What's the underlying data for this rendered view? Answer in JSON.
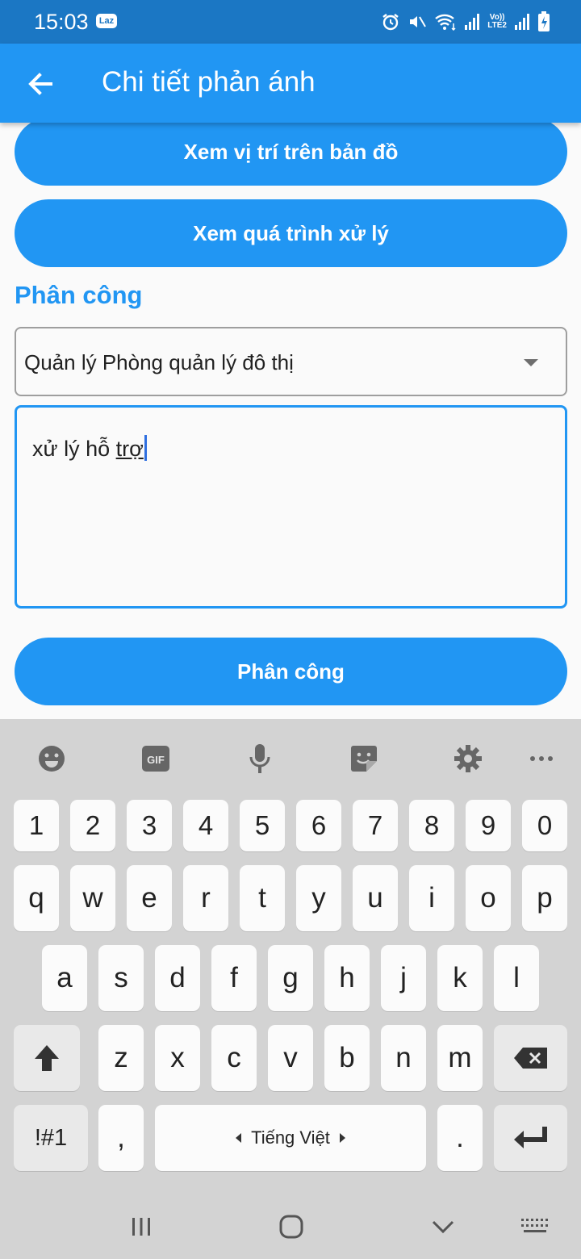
{
  "status_bar": {
    "time": "15:03",
    "notification_badge": "Laz",
    "icons": [
      "alarm-icon",
      "mute-icon",
      "wifi-icon",
      "signal-icon",
      "volte-icon",
      "signal-icon",
      "battery-charging-icon"
    ],
    "volte_top": "Vo))",
    "volte_bottom": "LTE2"
  },
  "app_bar": {
    "title": "Chi tiết phản ánh",
    "back_icon": "arrow-left-icon"
  },
  "content": {
    "map_button": "Xem vị trí trên bản đồ",
    "process_button": "Xem quá trình xử lý",
    "section_title": "Phân công",
    "dropdown_value": "Quản lý Phòng quản lý đô thị",
    "note_text_plain": "xử lý hỗ ",
    "note_text_composing": "trợ",
    "submit_button": "Phân công"
  },
  "keyboard": {
    "toolbar": [
      "emoji-icon",
      "gif-icon",
      "microphone-icon",
      "sticker-icon",
      "settings-icon",
      "more-icon"
    ],
    "gif_label": "GIF",
    "row_numbers": [
      "1",
      "2",
      "3",
      "4",
      "5",
      "6",
      "7",
      "8",
      "9",
      "0"
    ],
    "row_1": [
      "q",
      "w",
      "e",
      "r",
      "t",
      "y",
      "u",
      "i",
      "o",
      "p"
    ],
    "row_2": [
      "a",
      "s",
      "d",
      "f",
      "g",
      "h",
      "j",
      "k",
      "l"
    ],
    "row_3": [
      "z",
      "x",
      "c",
      "v",
      "b",
      "n",
      "m"
    ],
    "symbols_key": "!#1",
    "comma_key": ",",
    "space_label": "Tiếng Việt",
    "period_key": "."
  },
  "nav_bar": {
    "icons": [
      "recents-icon",
      "home-icon",
      "back-chevron-icon",
      "keyboard-icon"
    ]
  },
  "colors": {
    "primary": "#2196f3",
    "status_bar": "#1b77c4",
    "keyboard_bg": "#d3d3d3"
  }
}
